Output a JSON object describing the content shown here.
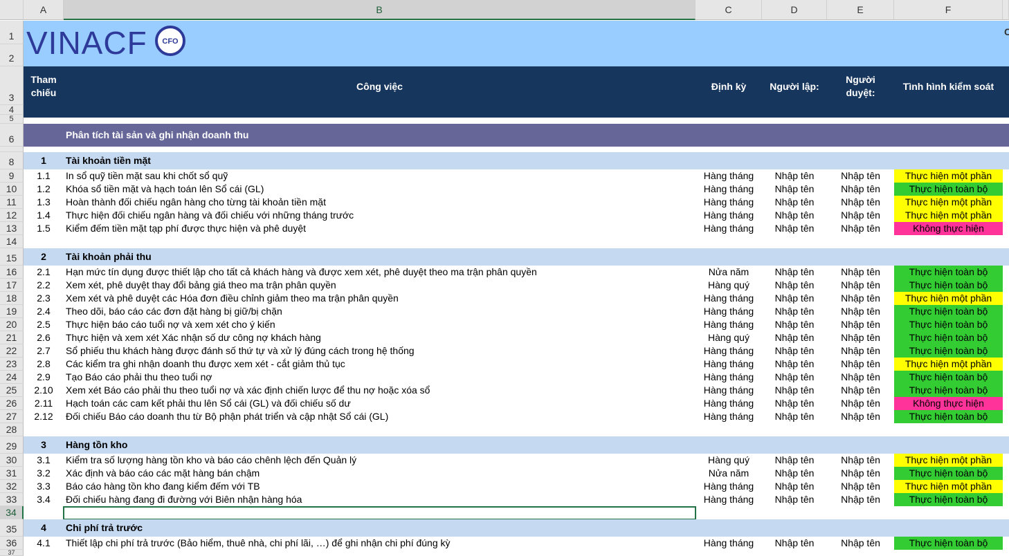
{
  "columns": [
    "A",
    "B",
    "C",
    "D",
    "E",
    "F"
  ],
  "logo": {
    "text": "VINACF",
    "badge": "CFO",
    "partial_right": "C"
  },
  "header": {
    "col_a": [
      "Tham",
      "chiếu"
    ],
    "col_b": "Công việc",
    "col_c": "Định kỳ",
    "col_d": "Người lập:",
    "col_e": [
      "Người",
      "duyệt:"
    ],
    "col_f": "Tình hình kiểm soát"
  },
  "section_title": "Phân tích tài sản và ghi nhận doanh thu",
  "cat1": {
    "num": "1",
    "title": "Tài khoản tiền mặt"
  },
  "cat2": {
    "num": "2",
    "title": "Tài khoản phải thu"
  },
  "cat3": {
    "num": "3",
    "title": "Hàng tồn kho"
  },
  "cat4": {
    "num": "4",
    "title": "Chi phí trả trước"
  },
  "r9": {
    "ref": "1.1",
    "task": "In sổ quỹ tiền mặt sau khi chốt sổ quỹ",
    "period": "Hàng tháng",
    "maker": "Nhập tên",
    "approver": "Nhập tên",
    "status": "Thực hiện một phần",
    "status_color": "#ffff00"
  },
  "r10": {
    "ref": "1.2",
    "task": "Khóa sổ tiền mặt và hạch toán lên Sổ cái (GL)",
    "period": "Hàng tháng",
    "maker": "Nhập tên",
    "approver": "Nhập tên",
    "status": "Thực hiện toàn bộ",
    "status_color": "#33cc33"
  },
  "r11": {
    "ref": "1.3",
    "task": "Hoàn thành đối chiếu ngân hàng cho từng tài khoản tiền mặt",
    "period": "Hàng tháng",
    "maker": "Nhập tên",
    "approver": "Nhập tên",
    "status": "Thực hiện một phần",
    "status_color": "#ffff00"
  },
  "r12": {
    "ref": "1.4",
    "task": "Thực hiện đối chiếu ngân hàng và đối chiếu với những tháng trước",
    "period": "Hàng tháng",
    "maker": "Nhập tên",
    "approver": "Nhập tên",
    "status": "Thực hiện một phần",
    "status_color": "#ffff00"
  },
  "r13": {
    "ref": "1.5",
    "task": "Kiểm đếm tiền mặt tạp phí được thực hiện và phê duyệt",
    "period": "Hàng tháng",
    "maker": "Nhập tên",
    "approver": "Nhập tên",
    "status": "Không thực hiện",
    "status_color": "#ff3399"
  },
  "r16": {
    "ref": "2.1",
    "task": "Hạn mức tín dụng được thiết lập cho tất cả khách hàng và được xem xét, phê duyệt theo ma trận phân quyền",
    "period": "Nửa năm",
    "maker": "Nhập tên",
    "approver": "Nhập tên",
    "status": "Thực hiện toàn bộ",
    "status_color": "#33cc33"
  },
  "r17": {
    "ref": "2.2",
    "task": "Xem xét, phê duyệt thay đổi bảng giá theo ma trận phân quyền",
    "period": "Hàng quý",
    "maker": "Nhập tên",
    "approver": "Nhập tên",
    "status": "Thực hiện toàn bộ",
    "status_color": "#33cc33"
  },
  "r18": {
    "ref": "2.3",
    "task": "Xem xét và phê duyệt các Hóa đơn điều chỉnh giảm theo ma trận phân quyền",
    "period": "Hàng tháng",
    "maker": "Nhập tên",
    "approver": "Nhập tên",
    "status": "Thực hiện một phần",
    "status_color": "#ffff00"
  },
  "r19": {
    "ref": "2.4",
    "task": "Theo dõi, báo cáo các đơn đặt hàng bị giữ/bị chặn",
    "period": "Hàng tháng",
    "maker": "Nhập tên",
    "approver": "Nhập tên",
    "status": "Thực hiện toàn bộ",
    "status_color": "#33cc33"
  },
  "r20": {
    "ref": "2.5",
    "task": "Thực hiện báo cáo tuổi nợ và xem xét cho ý kiến",
    "period": "Hàng tháng",
    "maker": "Nhập tên",
    "approver": "Nhập tên",
    "status": "Thực hiện toàn bộ",
    "status_color": "#33cc33"
  },
  "r21": {
    "ref": "2.6",
    "task": "Thực hiện và xem xét Xác nhận số dư công nợ khách hàng",
    "period": "Hàng quý",
    "maker": "Nhập tên",
    "approver": "Nhập tên",
    "status": "Thực hiện toàn bộ",
    "status_color": "#33cc33"
  },
  "r22": {
    "ref": "2.7",
    "task": "Sổ phiếu thu khách hàng được đánh số thứ tự và xử lý đúng cách trong hệ thống",
    "period": "Hàng tháng",
    "maker": "Nhập tên",
    "approver": "Nhập tên",
    "status": "Thực hiện toàn bộ",
    "status_color": "#33cc33"
  },
  "r23": {
    "ref": "2.8",
    "task": "Các kiểm tra ghi nhận doanh thu được xem xét - cắt giảm thủ tục",
    "period": "Hàng tháng",
    "maker": "Nhập tên",
    "approver": "Nhập tên",
    "status": "Thực hiện một phần",
    "status_color": "#ffff00"
  },
  "r24": {
    "ref": "2.9",
    "task": "Tạo Báo cáo phải thu theo tuổi nợ",
    "period": "Hàng tháng",
    "maker": "Nhập tên",
    "approver": "Nhập tên",
    "status": "Thực hiện toàn bộ",
    "status_color": "#33cc33"
  },
  "r25": {
    "ref": "2.10",
    "task": "Xem xét Báo cáo phải thu theo tuổi nợ và xác định chiến lược để thu nợ hoặc xóa sổ",
    "period": "Hàng tháng",
    "maker": "Nhập tên",
    "approver": "Nhập tên",
    "status": "Thực hiện toàn bộ",
    "status_color": "#33cc33"
  },
  "r26": {
    "ref": "2.11",
    "task": "Hạch toán các cam kết phải thu lên Sổ cái (GL) và đối chiếu số dư",
    "period": "Hàng tháng",
    "maker": "Nhập tên",
    "approver": "Nhập tên",
    "status": "Không thực hiện",
    "status_color": "#ff3399"
  },
  "r27": {
    "ref": "2.12",
    "task": "Đối chiếu Báo cáo doanh thu từ Bộ phận phát triển và cập nhật Sổ cái (GL)",
    "period": "Hàng tháng",
    "maker": "Nhập tên",
    "approver": "Nhập tên",
    "status": "Thực hiện toàn bộ",
    "status_color": "#33cc33"
  },
  "r30": {
    "ref": "3.1",
    "task": "Kiểm tra số lượng hàng tồn kho và báo cáo chênh lệch đến Quản lý",
    "period": "Hàng quý",
    "maker": "Nhập tên",
    "approver": "Nhập tên",
    "status": "Thực hiện một phần",
    "status_color": "#ffff00"
  },
  "r31": {
    "ref": "3.2",
    "task": "Xác định và báo cáo các mặt hàng bán chậm",
    "period": "Nửa năm",
    "maker": "Nhập tên",
    "approver": "Nhập tên",
    "status": "Thực hiện toàn bộ",
    "status_color": "#33cc33"
  },
  "r32": {
    "ref": "3.3",
    "task": "Báo cáo hàng tồn kho đang kiểm đếm với TB",
    "period": "Hàng tháng",
    "maker": "Nhập tên",
    "approver": "Nhập tên",
    "status": "Thực hiện một phần",
    "status_color": "#ffff00"
  },
  "r33": {
    "ref": "3.4",
    "task": "Đối chiếu hàng đang đi đường với Biên nhận hàng hóa",
    "period": "Hàng tháng",
    "maker": "Nhập tên",
    "approver": "Nhập tên",
    "status": "Thực hiện toàn bộ",
    "status_color": "#33cc33"
  },
  "r36": {
    "ref": "4.1",
    "task": "Thiết lập chi phí trả trước (Bảo hiểm, thuê nhà, chi phí lãi, …) để ghi nhận chi phí đúng kỳ",
    "period": "Hàng tháng",
    "maker": "Nhập tên",
    "approver": "Nhập tên",
    "status": "Thực hiện toàn bộ",
    "status_color": "#33cc33"
  }
}
